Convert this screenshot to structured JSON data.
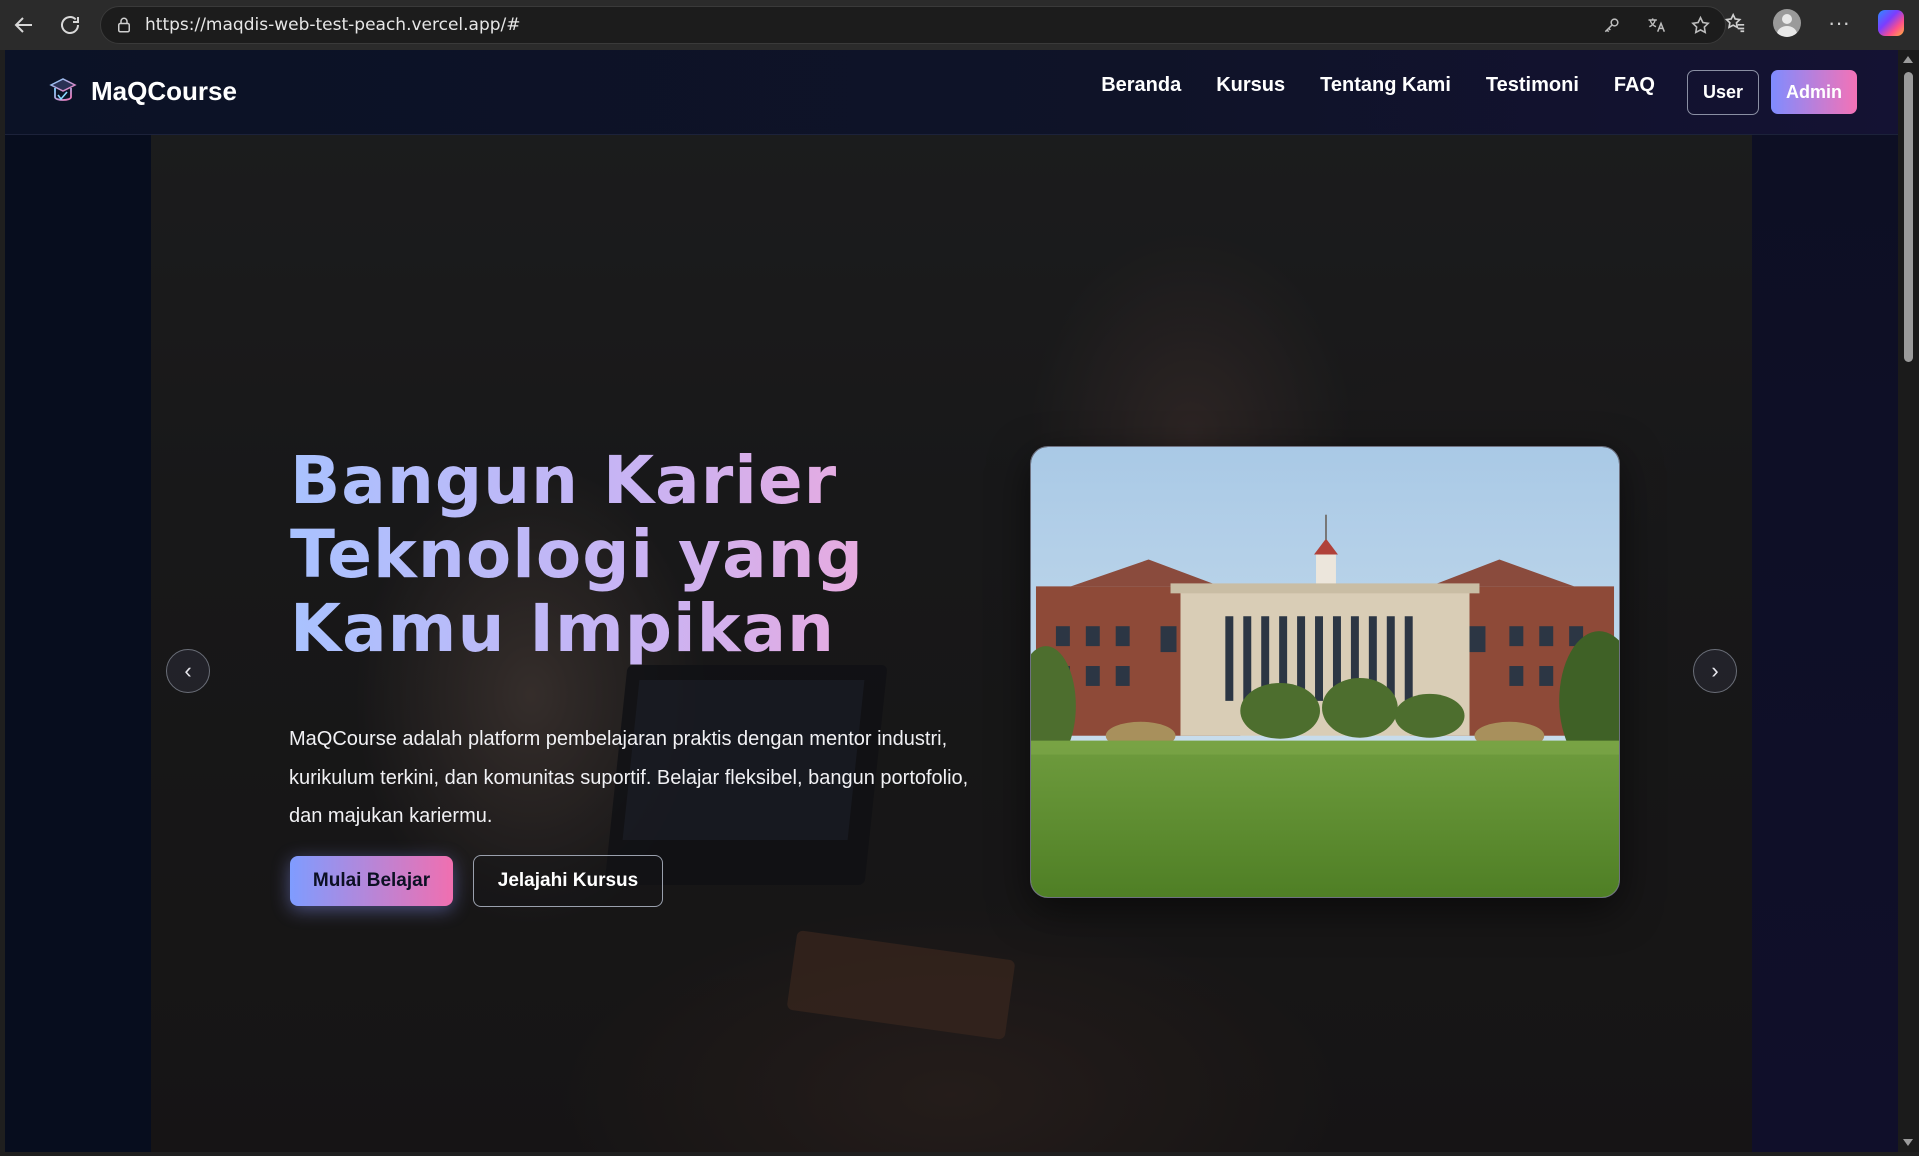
{
  "browser": {
    "url": "https://maqdis-web-test-peach.vercel.app/#",
    "icons": [
      "back-icon",
      "reload-icon",
      "lock-icon",
      "key-icon",
      "translate-icon",
      "star-icon",
      "favorites-icon",
      "profile-icon",
      "more-icon",
      "copilot-icon"
    ]
  },
  "navbar": {
    "brand": "MaQCourse",
    "links": [
      "Beranda",
      "Kursus",
      "Tentang Kami",
      "Testimoni",
      "FAQ"
    ],
    "user_label": "User",
    "admin_label": "Admin"
  },
  "hero": {
    "title_lines": [
      "Bangun Karier",
      "Teknologi yang",
      "Kamu Impikan"
    ],
    "description": "MaQCourse adalah platform pembelajaran praktis dengan mentor industri, kurikulum terkini, dan komunitas suportif. Belajar fleksibel, bangun portofolio, dan majukan kariermu.",
    "primary_cta": "Mulai Belajar",
    "secondary_cta": "Jelajahi Kursus",
    "prev_arrow": "‹",
    "next_arrow": "›"
  },
  "colors": {
    "accent_start": "#7f9cff",
    "accent_end": "#f06fb0",
    "page_bg": "#0a0f1f"
  }
}
